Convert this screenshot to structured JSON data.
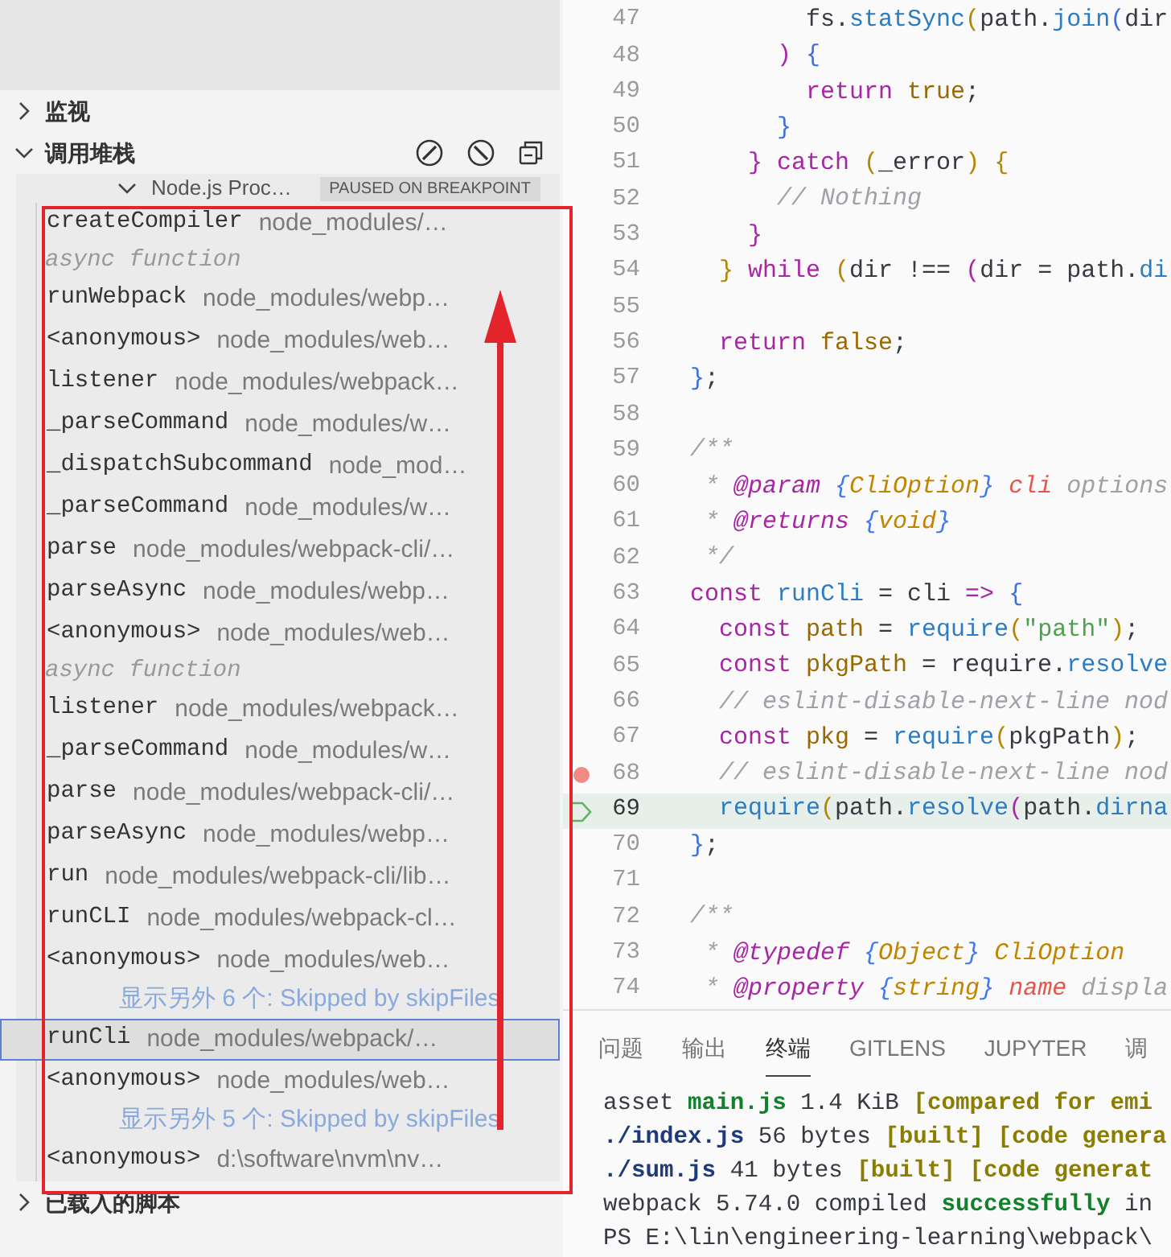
{
  "sidebar": {
    "sections": [
      {
        "title": "监视",
        "expanded": false
      },
      {
        "title": "调用堆栈",
        "expanded": true
      }
    ],
    "call_stack": {
      "thread": {
        "name": "Node.js Proc…",
        "status": "PAUSED ON BREAKPOINT",
        "expanded": true
      },
      "frames": [
        {
          "kind": "frame",
          "function": "createCompiler",
          "source": "node_modules/…",
          "selected": false
        },
        {
          "kind": "async",
          "text": "async function"
        },
        {
          "kind": "frame",
          "function": "runWebpack",
          "source": "node_modules/webp…",
          "selected": false
        },
        {
          "kind": "frame",
          "function": "<anonymous>",
          "source": "node_modules/web…",
          "selected": false
        },
        {
          "kind": "frame",
          "function": "listener",
          "source": "node_modules/webpack…",
          "selected": false
        },
        {
          "kind": "frame",
          "function": "_parseCommand",
          "source": "node_modules/w…",
          "selected": false
        },
        {
          "kind": "frame",
          "function": "_dispatchSubcommand",
          "source": "node_mod…",
          "selected": false
        },
        {
          "kind": "frame",
          "function": "_parseCommand",
          "source": "node_modules/w…",
          "selected": false
        },
        {
          "kind": "frame",
          "function": "parse",
          "source": "node_modules/webpack-cli/…",
          "selected": false
        },
        {
          "kind": "frame",
          "function": "parseAsync",
          "source": "node_modules/webp…",
          "selected": false
        },
        {
          "kind": "frame",
          "function": "<anonymous>",
          "source": "node_modules/web…",
          "selected": false
        },
        {
          "kind": "async",
          "text": "async function"
        },
        {
          "kind": "frame",
          "function": "listener",
          "source": "node_modules/webpack…",
          "selected": false
        },
        {
          "kind": "frame",
          "function": "_parseCommand",
          "source": "node_modules/w…",
          "selected": false
        },
        {
          "kind": "frame",
          "function": "parse",
          "source": "node_modules/webpack-cli/…",
          "selected": false
        },
        {
          "kind": "frame",
          "function": "parseAsync",
          "source": "node_modules/webp…",
          "selected": false
        },
        {
          "kind": "frame",
          "function": "run",
          "source": "node_modules/webpack-cli/lib…",
          "selected": false
        },
        {
          "kind": "frame",
          "function": "runCLI",
          "source": "node_modules/webpack-cl…",
          "selected": false
        },
        {
          "kind": "frame",
          "function": "<anonymous>",
          "source": "node_modules/web…",
          "selected": false
        },
        {
          "kind": "skipped",
          "text": "显示另外 6 个: Skipped by skipFiles"
        },
        {
          "kind": "frame",
          "function": "runCli",
          "source": "node_modules/webpack/…",
          "selected": true
        },
        {
          "kind": "frame",
          "function": "<anonymous>",
          "source": "node_modules/web…",
          "selected": false
        },
        {
          "kind": "skipped",
          "text": "显示另外 5 个: Skipped by skipFiles"
        },
        {
          "kind": "frame",
          "function": "<anonymous>",
          "source": "d:\\software\\nvm\\nv…",
          "selected": false
        }
      ]
    },
    "loaded_scripts": {
      "title": "已载入的脚本",
      "expanded": false
    }
  },
  "editor": {
    "lines": [
      {
        "number": "47",
        "breakpoint": false,
        "current": false,
        "tokens": [
          {
            "kind": "plain",
            "text": "        fs."
          },
          {
            "kind": "function",
            "text": "statSync"
          },
          {
            "kind": "bracket1",
            "text": "("
          },
          {
            "kind": "plain",
            "text": "path."
          },
          {
            "kind": "function",
            "text": "join"
          },
          {
            "kind": "bracket2",
            "text": "("
          },
          {
            "kind": "plain",
            "text": "dir"
          }
        ]
      },
      {
        "number": "48",
        "breakpoint": false,
        "current": false,
        "tokens": [
          {
            "kind": "bracket3",
            "text": "      )"
          },
          {
            "kind": "bracket2",
            "text": " {"
          }
        ]
      },
      {
        "number": "49",
        "breakpoint": false,
        "current": false,
        "tokens": [
          {
            "kind": "keyword",
            "text": "        return"
          },
          {
            "kind": "literal",
            "text": " true"
          },
          {
            "kind": "plain",
            "text": ";"
          }
        ]
      },
      {
        "number": "50",
        "breakpoint": false,
        "current": false,
        "tokens": [
          {
            "kind": "bracket2",
            "text": "      }"
          }
        ]
      },
      {
        "number": "51",
        "breakpoint": false,
        "current": false,
        "tokens": [
          {
            "kind": "bracket3",
            "text": "    }"
          },
          {
            "kind": "keyword",
            "text": " catch"
          },
          {
            "kind": "bracket1",
            "text": " ("
          },
          {
            "kind": "plain",
            "text": "_error"
          },
          {
            "kind": "bracket1",
            "text": ")"
          },
          {
            "kind": "bracket1",
            "text": " {"
          }
        ]
      },
      {
        "number": "52",
        "breakpoint": false,
        "current": false,
        "tokens": [
          {
            "kind": "comment",
            "text": "      // Nothing"
          }
        ]
      },
      {
        "number": "53",
        "breakpoint": false,
        "current": false,
        "tokens": [
          {
            "kind": "bracket3",
            "text": "    }"
          }
        ]
      },
      {
        "number": "54",
        "breakpoint": false,
        "current": false,
        "tokens": [
          {
            "kind": "bracket1",
            "text": "  }"
          },
          {
            "kind": "keyword",
            "text": " while"
          },
          {
            "kind": "bracket1",
            "text": " ("
          },
          {
            "kind": "plain",
            "text": "dir !== "
          },
          {
            "kind": "bracket3",
            "text": "("
          },
          {
            "kind": "plain",
            "text": "dir = path."
          },
          {
            "kind": "function",
            "text": "di"
          }
        ]
      },
      {
        "number": "55",
        "breakpoint": false,
        "current": false
      },
      {
        "number": "56",
        "breakpoint": false,
        "current": false,
        "tokens": [
          {
            "kind": "keyword",
            "text": "  return"
          },
          {
            "kind": "literal",
            "text": " false"
          },
          {
            "kind": "plain",
            "text": ";"
          }
        ]
      },
      {
        "number": "57",
        "breakpoint": false,
        "current": false,
        "tokens": [
          {
            "kind": "bracket2",
            "text": "}"
          },
          {
            "kind": "plain",
            "text": ";"
          }
        ]
      },
      {
        "number": "58",
        "breakpoint": false,
        "current": false
      },
      {
        "number": "59",
        "breakpoint": false,
        "current": false,
        "tokens": [
          {
            "kind": "comment",
            "text": "/**"
          }
        ]
      },
      {
        "number": "60",
        "breakpoint": false,
        "current": false,
        "tokens": [
          {
            "kind": "comment",
            "text": " * "
          },
          {
            "kind": "doctag",
            "text": "@param"
          },
          {
            "kind": "docbrace",
            "text": " {"
          },
          {
            "kind": "type",
            "text": "CliOption"
          },
          {
            "kind": "docbrace",
            "text": "}"
          },
          {
            "kind": "param",
            "text": " cli"
          },
          {
            "kind": "comment",
            "text": " options"
          }
        ]
      },
      {
        "number": "61",
        "breakpoint": false,
        "current": false,
        "tokens": [
          {
            "kind": "comment",
            "text": " * "
          },
          {
            "kind": "doctag",
            "text": "@returns"
          },
          {
            "kind": "docbrace",
            "text": " {"
          },
          {
            "kind": "type",
            "text": "void"
          },
          {
            "kind": "docbrace",
            "text": "}"
          }
        ]
      },
      {
        "number": "62",
        "breakpoint": false,
        "current": false,
        "tokens": [
          {
            "kind": "comment",
            "text": " */"
          }
        ]
      },
      {
        "number": "63",
        "breakpoint": false,
        "current": false,
        "tokens": [
          {
            "kind": "keyword",
            "text": "const"
          },
          {
            "kind": "function",
            "text": " runCli"
          },
          {
            "kind": "plain",
            "text": " = cli "
          },
          {
            "kind": "keyword",
            "text": "=>"
          },
          {
            "kind": "bracket2",
            "text": " {"
          }
        ]
      },
      {
        "number": "64",
        "breakpoint": false,
        "current": false,
        "tokens": [
          {
            "kind": "keyword",
            "text": "  const"
          },
          {
            "kind": "variable",
            "text": " path"
          },
          {
            "kind": "plain",
            "text": " = "
          },
          {
            "kind": "function",
            "text": "require"
          },
          {
            "kind": "bracket1",
            "text": "("
          },
          {
            "kind": "string",
            "text": "\"path\""
          },
          {
            "kind": "bracket1",
            "text": ")"
          },
          {
            "kind": "plain",
            "text": ";"
          }
        ]
      },
      {
        "number": "65",
        "breakpoint": false,
        "current": false,
        "tokens": [
          {
            "kind": "keyword",
            "text": "  const"
          },
          {
            "kind": "variable",
            "text": " pkgPath"
          },
          {
            "kind": "plain",
            "text": " = require."
          },
          {
            "kind": "function",
            "text": "resolve"
          }
        ]
      },
      {
        "number": "66",
        "breakpoint": false,
        "current": false,
        "tokens": [
          {
            "kind": "comment",
            "text": "  // eslint-disable-next-line nod"
          }
        ]
      },
      {
        "number": "67",
        "breakpoint": false,
        "current": false,
        "tokens": [
          {
            "kind": "keyword",
            "text": "  const"
          },
          {
            "kind": "variable",
            "text": " pkg"
          },
          {
            "kind": "plain",
            "text": " = "
          },
          {
            "kind": "function",
            "text": "require"
          },
          {
            "kind": "bracket1",
            "text": "("
          },
          {
            "kind": "plain",
            "text": "pkgPath"
          },
          {
            "kind": "bracket1",
            "text": ")"
          },
          {
            "kind": "plain",
            "text": ";"
          }
        ]
      },
      {
        "number": "68",
        "breakpoint": true,
        "current": false,
        "tokens": [
          {
            "kind": "comment",
            "text": "  // eslint-disable-next-line nod"
          }
        ]
      },
      {
        "number": "69",
        "breakpoint": false,
        "current": true,
        "tokens": [
          {
            "kind": "function",
            "text": "  require"
          },
          {
            "kind": "bracket1",
            "text": "("
          },
          {
            "kind": "plain",
            "text": "path."
          },
          {
            "kind": "function",
            "text": "resolve"
          },
          {
            "kind": "bracket3",
            "text": "("
          },
          {
            "kind": "plain",
            "text": "path."
          },
          {
            "kind": "function",
            "text": "dirna"
          }
        ]
      },
      {
        "number": "70",
        "breakpoint": false,
        "current": false,
        "tokens": [
          {
            "kind": "bracket2",
            "text": "}"
          },
          {
            "kind": "plain",
            "text": ";"
          }
        ]
      },
      {
        "number": "71",
        "breakpoint": false,
        "current": false
      },
      {
        "number": "72",
        "breakpoint": false,
        "current": false,
        "tokens": [
          {
            "kind": "comment",
            "text": "/**"
          }
        ]
      },
      {
        "number": "73",
        "breakpoint": false,
        "current": false,
        "tokens": [
          {
            "kind": "comment",
            "text": " * "
          },
          {
            "kind": "doctag",
            "text": "@typedef"
          },
          {
            "kind": "docbrace",
            "text": " {"
          },
          {
            "kind": "type",
            "text": "Object"
          },
          {
            "kind": "docbrace",
            "text": "}"
          },
          {
            "kind": "type",
            "text": " CliOption"
          }
        ]
      },
      {
        "number": "74",
        "breakpoint": false,
        "current": false,
        "tokens": [
          {
            "kind": "comment",
            "text": " * "
          },
          {
            "kind": "doctag",
            "text": "@property"
          },
          {
            "kind": "docbrace",
            "text": " {"
          },
          {
            "kind": "type",
            "text": "string"
          },
          {
            "kind": "docbrace",
            "text": "}"
          },
          {
            "kind": "param",
            "text": " name"
          },
          {
            "kind": "comment",
            "text": " displa"
          }
        ]
      }
    ]
  },
  "panel": {
    "tabs": [
      {
        "label": "问题",
        "selected": false
      },
      {
        "label": "输出",
        "selected": false
      },
      {
        "label": "终端",
        "selected": true
      },
      {
        "label": "GITLENS",
        "selected": false
      },
      {
        "label": "JUPYTER",
        "selected": false
      },
      {
        "label": "调",
        "selected": false
      }
    ],
    "terminal": [
      [
        {
          "kind": "plain",
          "text": "asset "
        },
        {
          "kind": "success",
          "text": "main.js"
        },
        {
          "kind": "plain",
          "text": " 1.4 KiB "
        },
        {
          "kind": "info",
          "text": "[compared for emi"
        }
      ],
      [
        {
          "kind": "file",
          "text": "./index.js"
        },
        {
          "kind": "plain",
          "text": " 56 bytes "
        },
        {
          "kind": "info",
          "text": "[built] [code genera"
        }
      ],
      [
        {
          "kind": "file",
          "text": "./sum.js"
        },
        {
          "kind": "plain",
          "text": " 41 bytes "
        },
        {
          "kind": "info",
          "text": "[built] [code generat"
        }
      ],
      [
        {
          "kind": "plain",
          "text": "webpack 5.74.0 compiled "
        },
        {
          "kind": "success",
          "text": "successfully"
        },
        {
          "kind": "plain",
          "text": " in"
        }
      ],
      [
        {
          "kind": "plain",
          "text": "PS E:\\lin\\engineering-learning\\webpack\\"
        }
      ]
    ]
  },
  "annotation": {
    "frame": true,
    "arrow": true
  }
}
